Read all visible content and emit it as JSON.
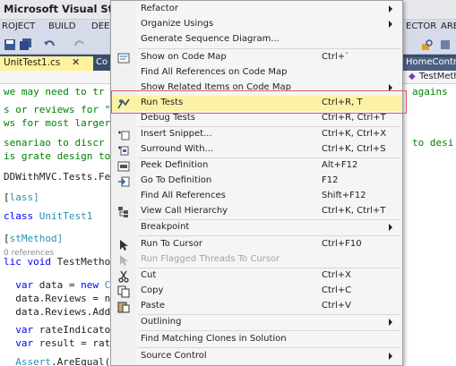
{
  "window": {
    "title": "Microsoft Visual Studi"
  },
  "menubar": {
    "items": [
      "ROJECT",
      "BUILD",
      "DEE",
      "ECTOR",
      "ARE"
    ]
  },
  "tabs": {
    "active": "UnitTest1.cs",
    "next": "Co",
    "right1": "HomeContro",
    "right2": "TestMeth"
  },
  "navbar": {
    "right": "TestMeth"
  },
  "code_lines": [
    {
      "t1": "we may need to tr",
      "t2": "agains"
    },
    {
      "t1": "s or reviews for \""
    },
    {
      "t1": "ws for most larger"
    },
    {
      "t1": "senariao to discr",
      "t2": "to desi"
    },
    {
      "t1": "is grate design to"
    },
    {
      "t1": "DDWithMVC.Tests.Fe"
    },
    {
      "t1": "lass]"
    },
    {
      "kw": "class",
      "typ": "UnitTest1"
    },
    {
      "t1": "stMethod]"
    },
    {
      "ref": "0 references"
    },
    {
      "kw": "lic void",
      "plain": "TestMetho"
    },
    {
      "kw": "var",
      "plain": "data = ",
      "kw2": "new",
      "typ": "Co"
    },
    {
      "plain": "data.Reviews = ne"
    },
    {
      "plain": "data.Reviews.Add("
    },
    {
      "kw": "var",
      "plain": "rateIndicator"
    },
    {
      "kw": "var",
      "plain": "result = rate"
    },
    {
      "typ": "Assert",
      "plain": ".AreEqual(4"
    }
  ],
  "context_menu": {
    "items": [
      {
        "label": "Refactor",
        "submenu": true,
        "icon": ""
      },
      {
        "label": "Organize Usings",
        "submenu": true,
        "icon": ""
      },
      {
        "label": "Generate Sequence Diagram...",
        "icon": ""
      },
      {
        "label": "Show on Code Map",
        "shortcut": "Ctrl+`",
        "icon": "code-map-icon"
      },
      {
        "label": "Find All References on Code Map",
        "icon": ""
      },
      {
        "label": "Show Related Items on Code Map",
        "submenu": true,
        "icon": ""
      },
      {
        "label": "Run Tests",
        "shortcut": "Ctrl+R, T",
        "icon": "run-tests-icon",
        "highlighted": true
      },
      {
        "label": "Debug Tests",
        "shortcut": "Ctrl+R, Ctrl+T",
        "icon": ""
      },
      {
        "label": "Insert Snippet...",
        "shortcut": "Ctrl+K, Ctrl+X",
        "icon": "insert-snippet-icon"
      },
      {
        "label": "Surround With...",
        "shortcut": "Ctrl+K, Ctrl+S",
        "icon": "surround-with-icon"
      },
      {
        "label": "Peek Definition",
        "shortcut": "Alt+F12",
        "icon": "peek-definition-icon"
      },
      {
        "label": "Go To Definition",
        "shortcut": "F12",
        "icon": "go-to-definition-icon"
      },
      {
        "label": "Find All References",
        "shortcut": "Shift+F12",
        "icon": ""
      },
      {
        "label": "View Call Hierarchy",
        "shortcut": "Ctrl+K, Ctrl+T",
        "icon": "call-hierarchy-icon"
      },
      {
        "label": "Breakpoint",
        "submenu": true,
        "icon": ""
      },
      {
        "label": "Run To Cursor",
        "shortcut": "Ctrl+F10",
        "icon": "run-to-cursor-icon"
      },
      {
        "label": "Run Flagged Threads To Cursor",
        "disabled": true,
        "icon": "run-flagged-threads-icon"
      },
      {
        "label": "Cut",
        "shortcut": "Ctrl+X",
        "icon": "cut-icon"
      },
      {
        "label": "Copy",
        "shortcut": "Ctrl+C",
        "icon": "copy-icon"
      },
      {
        "label": "Paste",
        "shortcut": "Ctrl+V",
        "icon": "paste-icon"
      },
      {
        "label": "Outlining",
        "submenu": true,
        "icon": ""
      },
      {
        "label": "Find Matching Clones in Solution",
        "icon": ""
      },
      {
        "label": "Source Control",
        "submenu": true,
        "icon": ""
      }
    ]
  },
  "colors": {
    "highlight": "#fcf2a7",
    "focus_outline": "#e05a5a",
    "tab_active": "#fff29d",
    "tabstrip": "#364e6f"
  }
}
